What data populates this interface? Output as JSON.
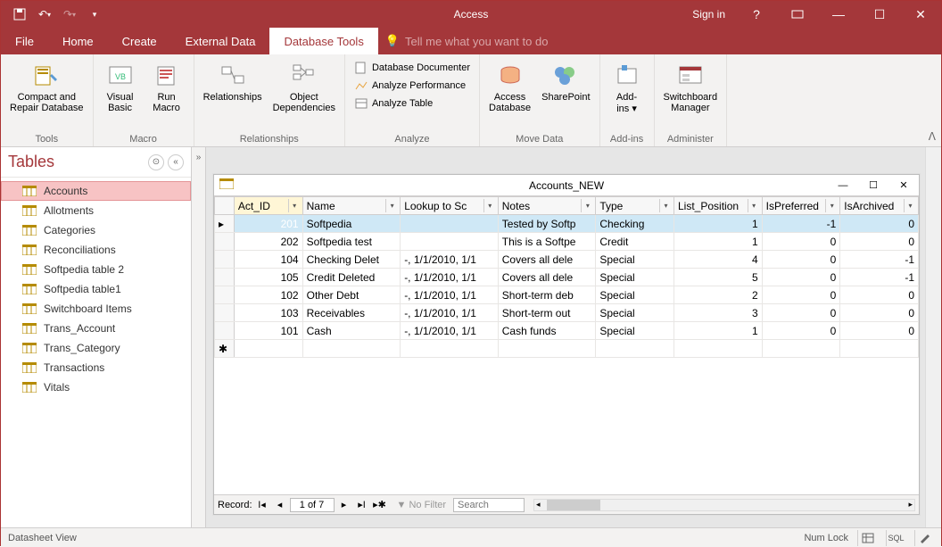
{
  "titlebar": {
    "app_title": "Access",
    "signin": "Sign in"
  },
  "menubar": {
    "tabs": [
      "File",
      "Home",
      "Create",
      "External Data",
      "Database Tools"
    ],
    "active_index": 4,
    "tellme_icon": "lightbulb-icon",
    "tellme": "Tell me what you want to do"
  },
  "ribbon": {
    "groups": [
      {
        "label": "Tools",
        "buttons": [
          {
            "name": "compact-repair",
            "label": "Compact and\nRepair Database"
          }
        ]
      },
      {
        "label": "Macro",
        "buttons": [
          {
            "name": "visual-basic",
            "label": "Visual\nBasic"
          },
          {
            "name": "run-macro",
            "label": "Run\nMacro"
          }
        ]
      },
      {
        "label": "Relationships",
        "buttons": [
          {
            "name": "relationships",
            "label": "Relationships"
          },
          {
            "name": "object-dependencies",
            "label": "Object\nDependencies"
          }
        ]
      },
      {
        "label": "Analyze",
        "list": [
          {
            "name": "db-documenter",
            "label": "Database Documenter"
          },
          {
            "name": "analyze-perf",
            "label": "Analyze Performance"
          },
          {
            "name": "analyze-table",
            "label": "Analyze Table"
          }
        ]
      },
      {
        "label": "Move Data",
        "buttons": [
          {
            "name": "access-database",
            "label": "Access\nDatabase"
          },
          {
            "name": "sharepoint",
            "label": "SharePoint"
          }
        ]
      },
      {
        "label": "Add-ins",
        "buttons": [
          {
            "name": "add-ins",
            "label": "Add-\nins ▾"
          }
        ]
      },
      {
        "label": "Administer",
        "buttons": [
          {
            "name": "switchboard-manager",
            "label": "Switchboard\nManager"
          }
        ]
      }
    ]
  },
  "nav": {
    "title": "Tables",
    "items": [
      "Accounts",
      "Allotments",
      "Categories",
      "Reconciliations",
      "Softpedia table 2",
      "Softpedia table1",
      "Switchboard Items",
      "Trans_Account",
      "Trans_Category",
      "Transactions",
      "Vitals"
    ],
    "selected_index": 0
  },
  "subwindow": {
    "title": "Accounts_NEW",
    "columns": [
      "Act_ID",
      "Name",
      "Lookup to Sc",
      "Notes",
      "Type",
      "List_Position",
      "IsPreferred",
      "IsArchived"
    ],
    "sort_col_index": 0,
    "rows": [
      {
        "sel": true,
        "id": "201",
        "name": "Softpedia",
        "lookup": "",
        "notes": "Tested by Softp",
        "type": "Checking",
        "pos": "1",
        "pref": "-1",
        "arch": "0"
      },
      {
        "sel": false,
        "id": "202",
        "name": "Softpedia test",
        "lookup": "",
        "notes": "This is a Softpe",
        "type": "Credit",
        "pos": "1",
        "pref": "0",
        "arch": "0"
      },
      {
        "sel": false,
        "id": "104",
        "name": "Checking Delet",
        "lookup": "-, 1/1/2010, 1/1",
        "notes": "Covers all dele",
        "type": "Special",
        "pos": "4",
        "pref": "0",
        "arch": "-1"
      },
      {
        "sel": false,
        "id": "105",
        "name": "Credit Deleted",
        "lookup": "-, 1/1/2010, 1/1",
        "notes": "Covers all dele",
        "type": "Special",
        "pos": "5",
        "pref": "0",
        "arch": "-1"
      },
      {
        "sel": false,
        "id": "102",
        "name": "Other Debt",
        "lookup": "-, 1/1/2010, 1/1",
        "notes": "Short-term deb",
        "type": "Special",
        "pos": "2",
        "pref": "0",
        "arch": "0"
      },
      {
        "sel": false,
        "id": "103",
        "name": "Receivables",
        "lookup": "-, 1/1/2010, 1/1",
        "notes": "Short-term out",
        "type": "Special",
        "pos": "3",
        "pref": "0",
        "arch": "0"
      },
      {
        "sel": false,
        "id": "101",
        "name": "Cash",
        "lookup": "-, 1/1/2010, 1/1",
        "notes": "Cash funds",
        "type": "Special",
        "pos": "1",
        "pref": "0",
        "arch": "0"
      }
    ],
    "new_row_marker": "✱"
  },
  "recnav": {
    "label": "Record:",
    "position": "1 of 7",
    "filter_label": "No Filter",
    "search_placeholder": "Search"
  },
  "statusbar": {
    "left": "Datasheet View",
    "numlock": "Num Lock"
  }
}
